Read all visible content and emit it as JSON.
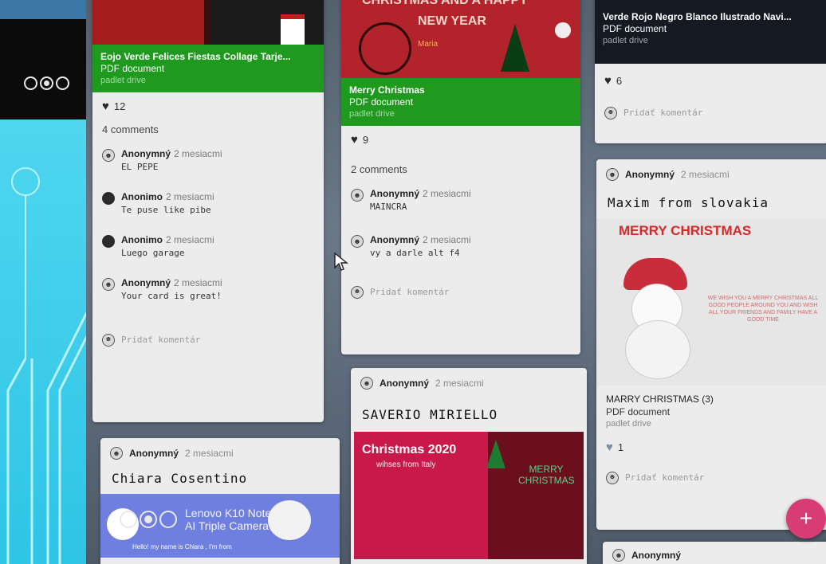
{
  "columns": {
    "col1": {
      "top_attachment": {
        "title": "Eojo Verde Felices Fiestas Collage Tarje...",
        "type": "PDF document",
        "source": "padlet drive"
      },
      "likes": "12",
      "comments_count": "4 comments",
      "comments": [
        {
          "author": "Anonymný",
          "time": "2 mesiacmi",
          "text": "EL PEPE",
          "avatar": "light"
        },
        {
          "author": "Anonimo",
          "time": "2 mesiacmi",
          "text": "Te puse like pibe",
          "avatar": "dark"
        },
        {
          "author": "Anonimo",
          "time": "2 mesiacmi",
          "text": "Luego garage",
          "avatar": "dark"
        },
        {
          "author": "Anonymný",
          "time": "2 mesiacmi",
          "text": "Your card is great!",
          "avatar": "light"
        }
      ],
      "add_comment": "Pridať komentár",
      "post2": {
        "author": "Anonymný",
        "time": "2 mesiacmi",
        "headline": "Chiara Cosentino",
        "image_caption": "Hello! my name is Chiara , I'm from"
      }
    },
    "col2": {
      "image_banner": "NEW YEAR",
      "image_banner_top": "CHRISTMAS AND A HAPPY",
      "image_name": "Maria",
      "attachment": {
        "title": "Merry Christmas",
        "type": "PDF document",
        "source": "padlet drive"
      },
      "likes": "9",
      "comments_count": "2 comments",
      "comments": [
        {
          "author": "Anonymný",
          "time": "2 mesiacmi",
          "text": "MAINCRA",
          "avatar": "light"
        },
        {
          "author": "Anonymný",
          "time": "2 mesiacmi",
          "text": "vy a darle alt f4",
          "avatar": "light"
        }
      ],
      "add_comment": "Pridať komentár",
      "post2": {
        "author": "Anonymný",
        "time": "2 mesiacmi",
        "headline": "SAVERIO MIRIELLO",
        "image_title": "Christmas 2020",
        "image_subtitle": "wihses from Italy",
        "image_side": "MERRY CHRISTMAS"
      }
    },
    "col3": {
      "attachment": {
        "title": "Verde Rojo Negro Blanco Ilustrado Navi...",
        "type": "PDF document",
        "source": "padlet drive"
      },
      "likes": "6",
      "add_comment": "Pridať komentár",
      "post2": {
        "author": "Anonymný",
        "time": "2 mesiacmi",
        "headline": "Maxim from slovakia",
        "image_title": "MERRY CHRISTMAS",
        "image_text": "WE WISH YOU A MERRY CHRISTMAS ALL GOOD PEOPLE AROUND YOU AND WISH ALL YOUR FRIENDS AND FAMILY HAVE A GOOD TIME",
        "attachment_title": "MARRY CHRISTMAS (3)",
        "attachment_type": "PDF document",
        "attachment_source": "padlet drive",
        "likes": "1",
        "add_comment": "Pridať komentár"
      },
      "post3_author": "Anonymný"
    }
  },
  "fab_label": "+",
  "watermark": {
    "line1": "Lenovo K10 Note",
    "line2": "AI Triple Camera"
  },
  "colors": {
    "attachment_green": "#1f9a1f",
    "fab_pink": "#d73c74",
    "slide_cyan": "#2ec4e6"
  }
}
